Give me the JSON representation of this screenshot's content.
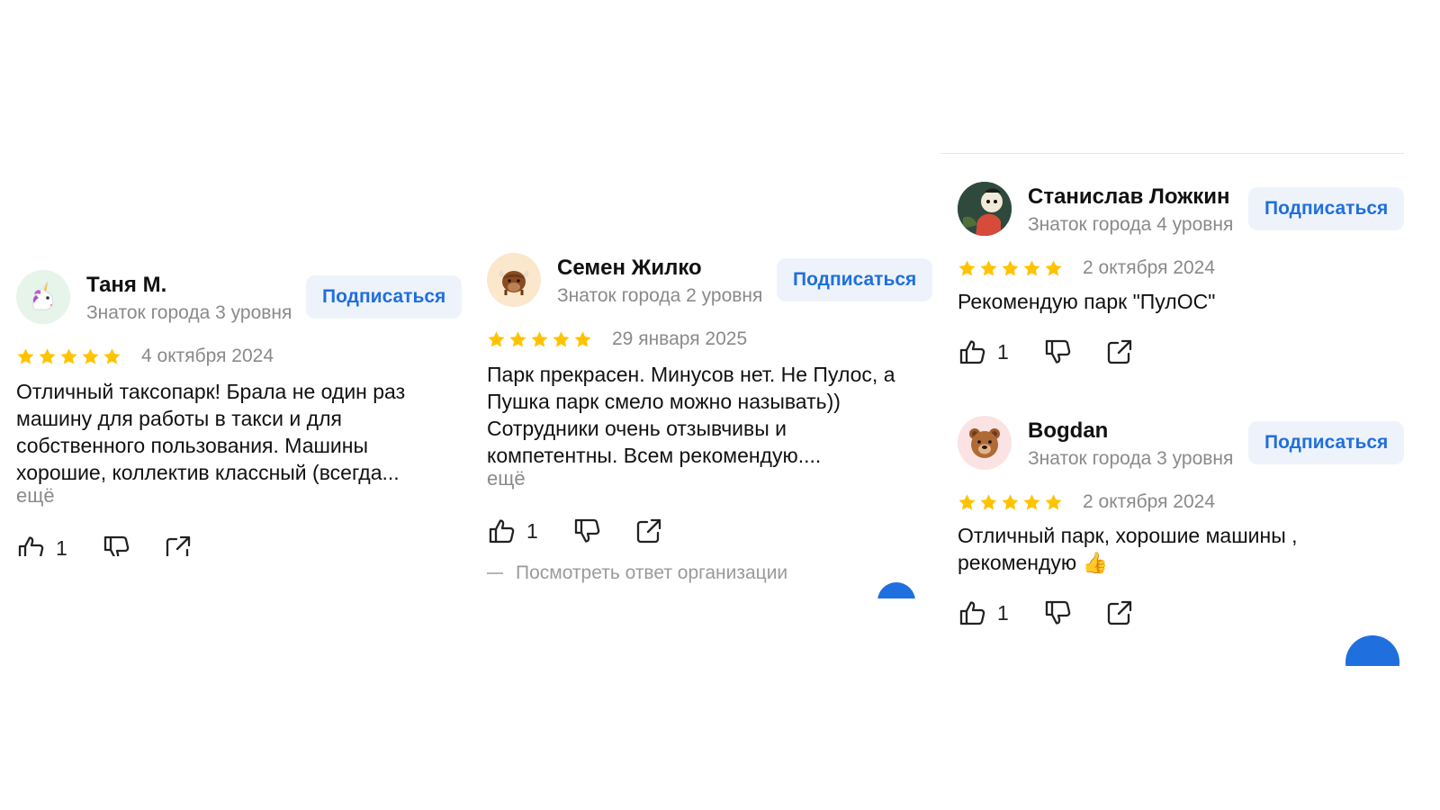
{
  "colors": {
    "accent": "#1f6fde",
    "star": "#ffc300",
    "muted": "#8a8a8a"
  },
  "reviews": [
    {
      "author": "Таня М.",
      "level": "Знаток города 3 уровня",
      "avatar_icon": "unicorn-icon",
      "subscribe_label": "Подписаться",
      "rating": 5,
      "date": "4 октября 2024",
      "text": "Отличный таксопарк! Брала не один раз\nмашину для работы в такси и для\nсобственного пользования. Машины\nхорошие, коллектив классный (всегда...",
      "more_label": "ещё",
      "likes": "1"
    },
    {
      "author": "Семен Жилко",
      "level": "Знаток города 2 уровня",
      "avatar_icon": "yak-icon",
      "subscribe_label": "Подписаться",
      "rating": 5,
      "date": "29 января 2025",
      "text": "Парк прекрасен. Минусов нет. Не Пулос, а\nПушка парк смело можно называть))\nСотрудники очень отзывчивы и\nкомпетентны. Всем рекомендую....",
      "more_label": "ещё",
      "likes": "1",
      "org_reply_label": "Посмотреть ответ организации"
    },
    {
      "author": "Станислав Ложкин",
      "level": "Знаток города 4 уровня",
      "avatar_icon": "cartoon-character-avatar-icon",
      "subscribe_label": "Подписаться",
      "rating": 5,
      "date": "2 октября 2024",
      "text": "Рекомендую парк \"ПулОС\"",
      "likes": "1"
    },
    {
      "author": "Bogdan",
      "level": "Знаток города 3 уровня",
      "avatar_icon": "bear-icon",
      "subscribe_label": "Подписаться",
      "rating": 5,
      "date": "2 октября 2024",
      "text": "Отличный парк, хорошие машины ,\nрекомендую 👍",
      "likes": "1"
    }
  ]
}
